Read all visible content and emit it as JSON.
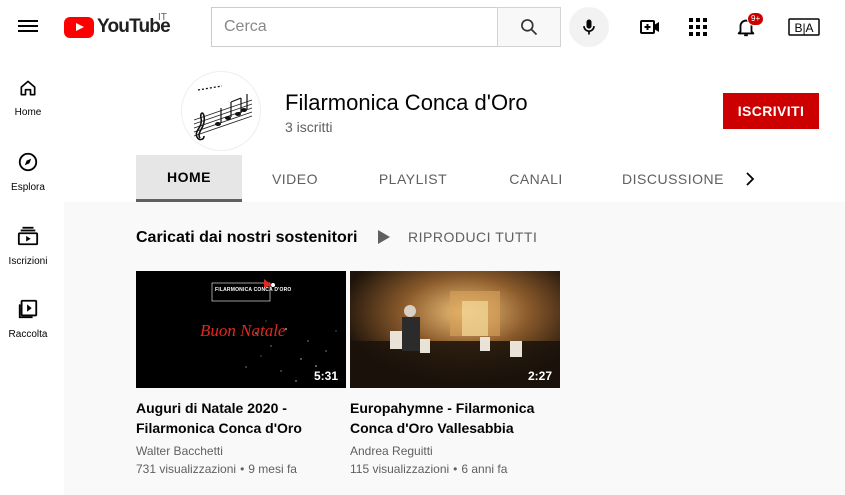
{
  "logo": {
    "text": "YouTube",
    "country": "IT"
  },
  "search": {
    "placeholder": "Cerca",
    "value": ""
  },
  "notifications": {
    "badge": "9+"
  },
  "avatar_initials": "B|A",
  "sidebar": {
    "items": [
      {
        "label": "Home",
        "icon": "home-icon"
      },
      {
        "label": "Esplora",
        "icon": "compass-icon"
      },
      {
        "label": "Iscrizioni",
        "icon": "subscriptions-icon"
      },
      {
        "label": "Raccolta",
        "icon": "library-icon"
      }
    ]
  },
  "channel": {
    "name": "Filarmonica Conca d'Oro",
    "subscribers": "3 iscritti",
    "subscribe_label": "ISCRIVITI"
  },
  "tabs": [
    {
      "label": "HOME",
      "active": true
    },
    {
      "label": "VIDEO",
      "active": false
    },
    {
      "label": "PLAYLIST",
      "active": false
    },
    {
      "label": "CANALI",
      "active": false
    },
    {
      "label": "DISCUSSIONE",
      "active": false
    }
  ],
  "section": {
    "title": "Caricati dai nostri sostenitori",
    "play_all": "RIPRODUCI TUTTI"
  },
  "videos": [
    {
      "title": "Auguri di Natale 2020 - Filarmonica Conca d'Oro",
      "author": "Walter Bacchetti",
      "views": "731 visualizzazioni",
      "age": "9 mesi fa",
      "duration": "5:31",
      "thumb_text": "Buon Natale",
      "thumb_logo": "FILARMONICA CONCA D'ORO"
    },
    {
      "title": "Europahymne - Filarmonica Conca d'Oro Vallesabbia",
      "author": "Andrea Reguitti",
      "views": "115 visualizzazioni",
      "age": "6 anni fa",
      "duration": "2:27"
    }
  ],
  "colors": {
    "brand_red": "#ff0000",
    "subscribe_red": "#cc0000",
    "thumb_text_red": "#e0281e"
  }
}
